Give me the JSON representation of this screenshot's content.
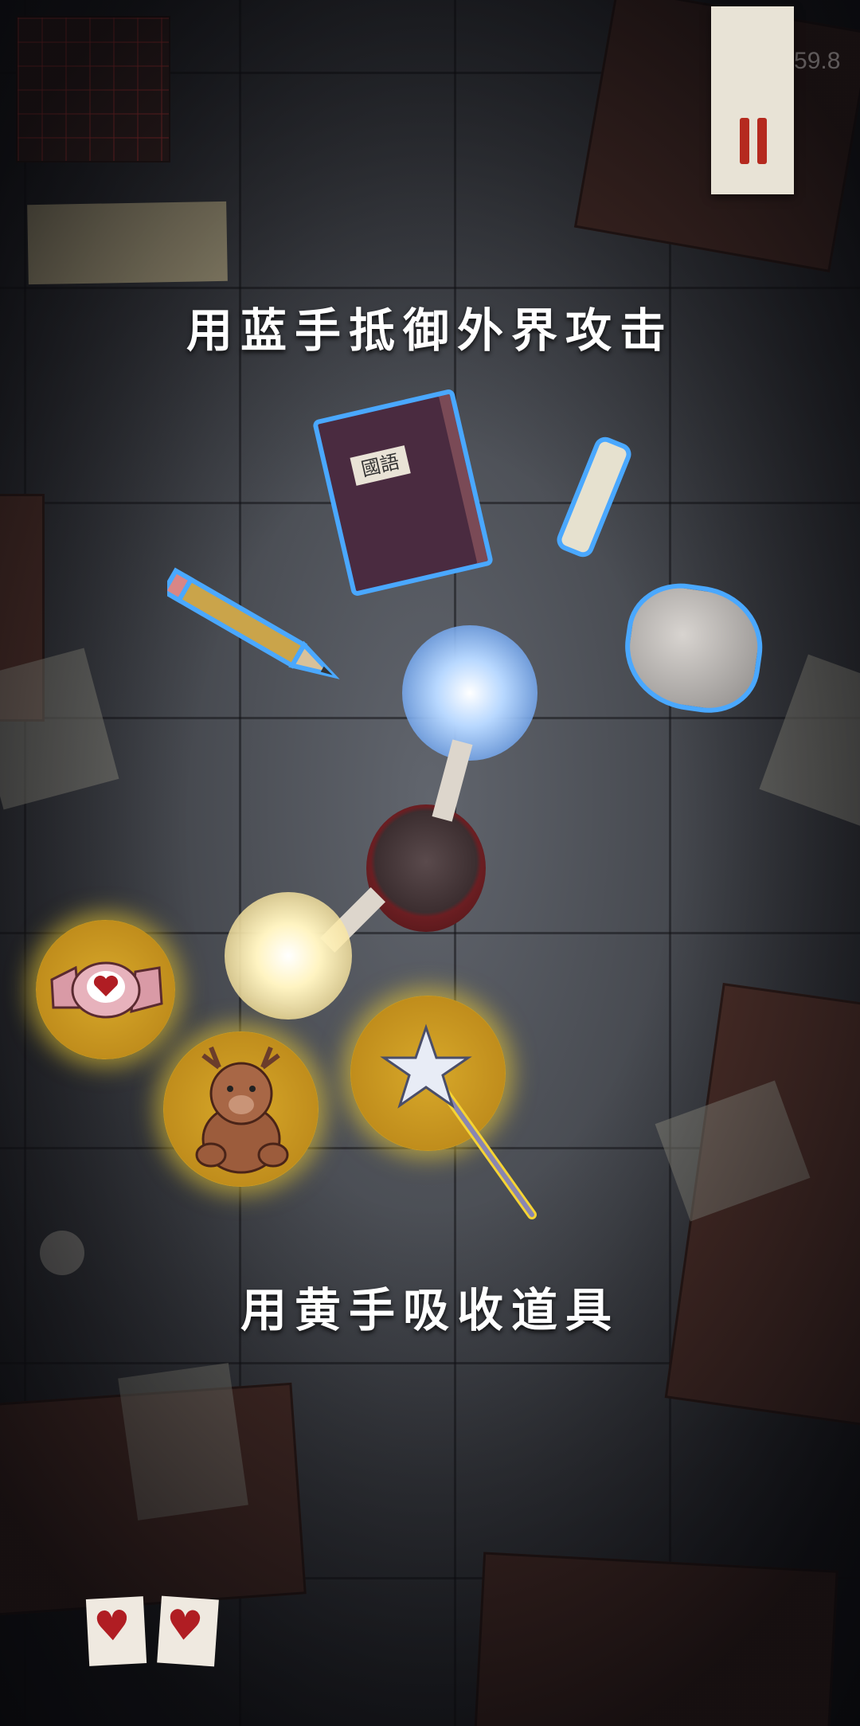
{
  "hud": {
    "fps_text": "FPS: 59.8",
    "pause_icon": "pause-icon"
  },
  "hints": {
    "top": "用蓝手抵御外界攻击",
    "bottom": "用黄手吸收道具"
  },
  "book": {
    "label": "國語"
  },
  "colors": {
    "blue_outline": "#4aa8ff",
    "yellow_glow": "#f6d433",
    "pause_red": "#b52a1f",
    "heart_red": "#b01d23"
  },
  "hazards": [
    "book-icon",
    "pencil-icon",
    "chalk-icon",
    "crumpled-paper-icon"
  ],
  "pickups": [
    "candy-icon",
    "teddy-bear-icon",
    "magic-wand-icon"
  ],
  "lives": 2
}
